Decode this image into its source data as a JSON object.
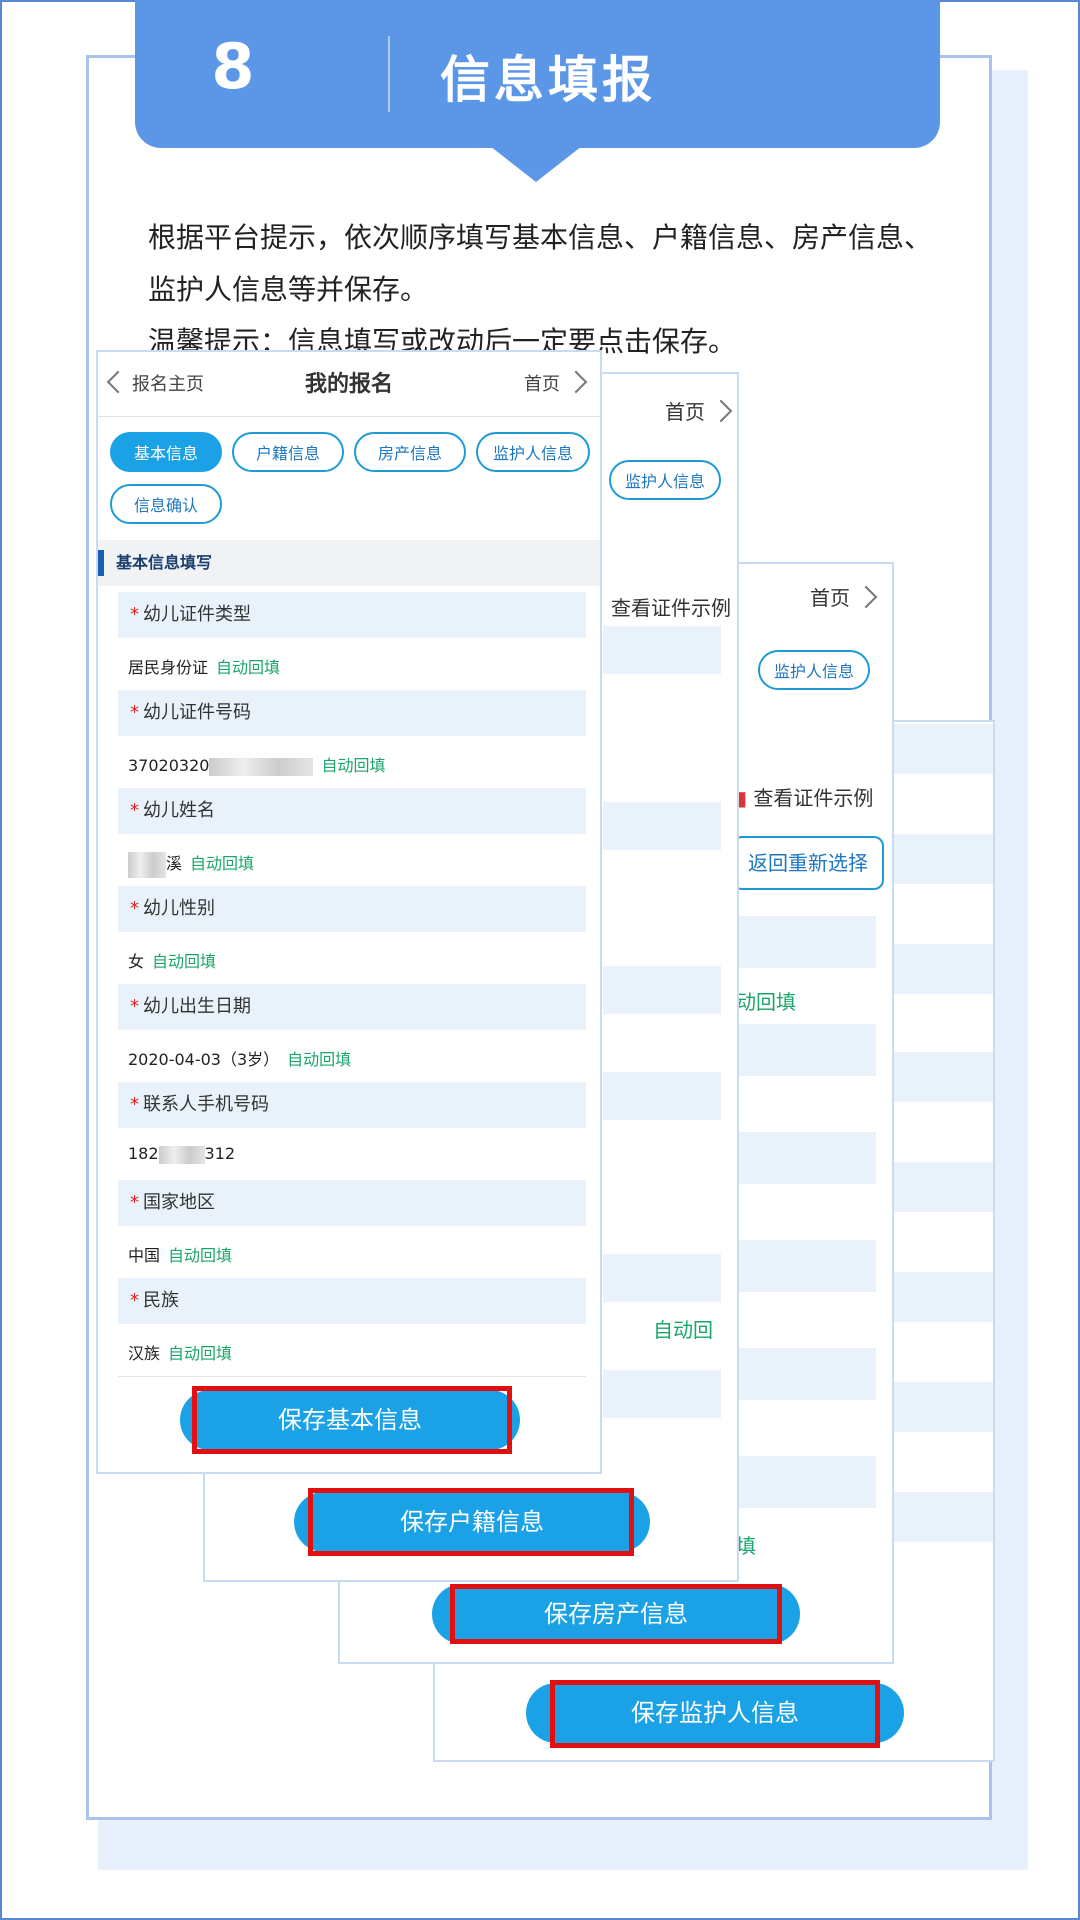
{
  "header": {
    "number": "8",
    "title": "信息填报"
  },
  "intro": {
    "line1": "根据平台提示，依次顺序填写基本信息、户籍信息、房产信息、",
    "line2": "监护人信息等并保存。",
    "line3": "温馨提示：信息填写或改动后一定要点击保存。"
  },
  "phone": {
    "back_label": "报名主页",
    "title": "我的报名",
    "home_label": "首页",
    "tabs": [
      "基本信息",
      "户籍信息",
      "房产信息",
      "监护人信息",
      "信息确认"
    ],
    "section_title": "基本信息填写",
    "fields": [
      {
        "label": "幼儿证件类型",
        "value": "居民身份证",
        "auto": "自动回填"
      },
      {
        "label": "幼儿证件号码",
        "value": "37020320",
        "auto": "自动回填"
      },
      {
        "label": "幼儿姓名",
        "value": "溪",
        "auto": "自动回填"
      },
      {
        "label": "幼儿性别",
        "value": "女",
        "auto": "自动回填"
      },
      {
        "label": "幼儿出生日期",
        "value": "2020-04-03（3岁）",
        "auto": "自动回填"
      },
      {
        "label": "联系人手机号码",
        "value_prefix": "182",
        "value_suffix": "312"
      },
      {
        "label": "国家地区",
        "value": "中国",
        "auto": "自动回填"
      },
      {
        "label": "民族",
        "value": "汉族",
        "auto": "自动回填"
      }
    ],
    "required_mark": "*"
  },
  "background_sheets": {
    "home_label": "首页",
    "guardian_tab": "监护人信息",
    "view_sample": "查看证件示例",
    "reselect": "返回重新选择",
    "auto_fill_partial_1": "动回填",
    "auto_fill_partial_2": "自动回",
    "auto_fill_partial_3": "填"
  },
  "buttons": {
    "save_basic": "保存基本信息",
    "save_household": "保存户籍信息",
    "save_property": "保存房产信息",
    "save_guardian": "保存监护人信息"
  },
  "colors": {
    "banner": "#5b97e6",
    "button": "#1ba2e6",
    "highlight": "#e01010",
    "auto_fill": "#1aa56a"
  }
}
